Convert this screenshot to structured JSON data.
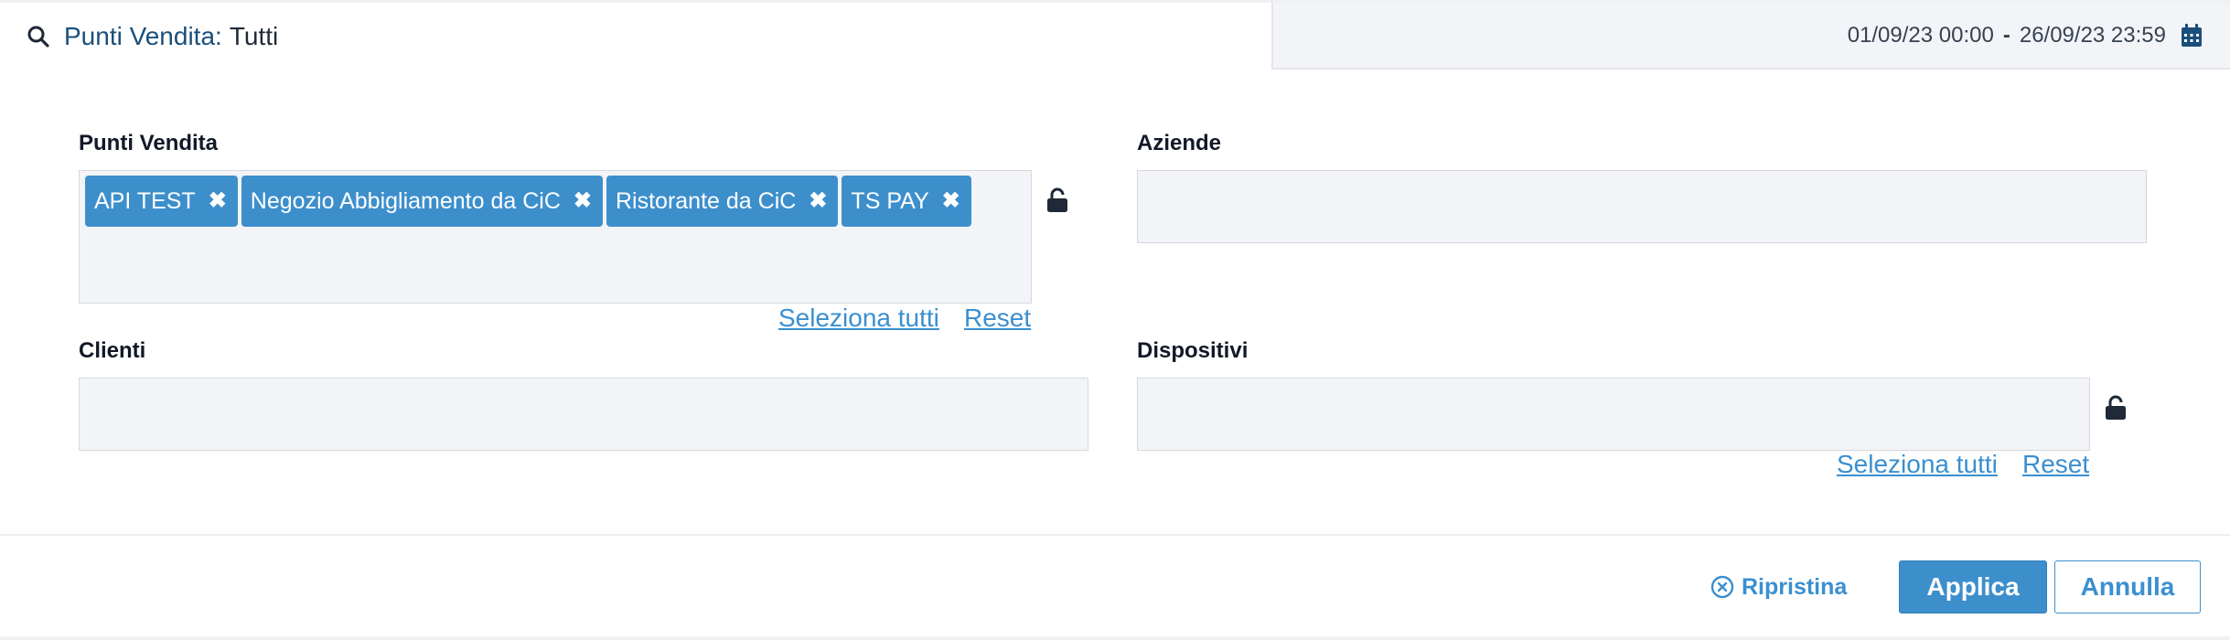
{
  "header": {
    "filter_label": "Punti Vendita:",
    "filter_value": "Tutti",
    "date_from": "01/09/23 00:00",
    "date_separator": "-",
    "date_to": "26/09/23 23:59"
  },
  "fields": {
    "punti_vendita": {
      "label": "Punti Vendita",
      "chips": [
        "API TEST",
        "Negozio Abbigliamento da CiC",
        "Ristorante da CiC",
        "TS PAY"
      ],
      "select_all": "Seleziona tutti",
      "reset": "Reset"
    },
    "aziende": {
      "label": "Aziende"
    },
    "clienti": {
      "label": "Clienti"
    },
    "dispositivi": {
      "label": "Dispositivi",
      "select_all": "Seleziona tutti",
      "reset": "Reset"
    }
  },
  "footer": {
    "reset_label": "Ripristina",
    "apply_label": "Applica",
    "cancel_label": "Annulla"
  },
  "colors": {
    "accent": "#3d8fcc",
    "link": "#3a8fd0",
    "field_bg": "#f3f4f7"
  },
  "icons": {
    "header": "search-icon",
    "date": "calendar-icon",
    "lock": "unlock-icon",
    "chip_remove": "close-icon",
    "reset": "x-circle-icon"
  }
}
